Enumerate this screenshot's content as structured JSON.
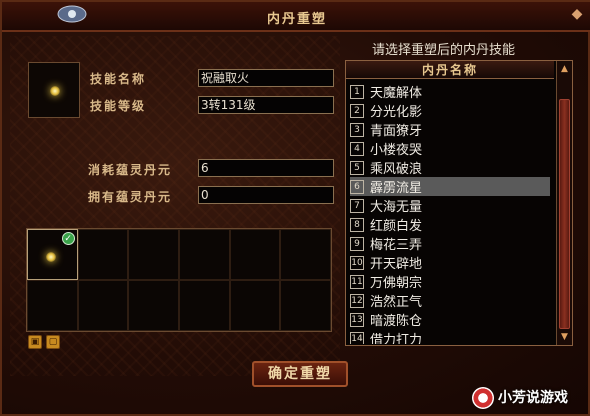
{
  "window": {
    "title": "内丹重塑",
    "close_label": "◆"
  },
  "skill": {
    "name_label": "技能名称",
    "name_value": "祝融取火",
    "level_label": "技能等级",
    "level_value": "3转131级"
  },
  "spirit": {
    "consume_label": "消耗蕴灵丹元",
    "consume_value": "6",
    "owned_label": "拥有蕴灵丹元",
    "owned_value": "0"
  },
  "inventory": {
    "slots": 12,
    "first_slot_checked": true
  },
  "actions": {
    "confirm_label": "确定重塑"
  },
  "list": {
    "prompt": "请选择重塑后的内丹技能",
    "header": "内丹名称",
    "selected_index": 5,
    "items": [
      {
        "num": "1",
        "name": "天魔解体"
      },
      {
        "num": "2",
        "name": "分光化影"
      },
      {
        "num": "3",
        "name": "青面獠牙"
      },
      {
        "num": "4",
        "name": "小楼夜哭"
      },
      {
        "num": "5",
        "name": "乘风破浪"
      },
      {
        "num": "6",
        "name": "霹雳流星"
      },
      {
        "num": "7",
        "name": "大海无量"
      },
      {
        "num": "8",
        "name": "红颜白发"
      },
      {
        "num": "9",
        "name": "梅花三弄"
      },
      {
        "num": "10",
        "name": "开天辟地"
      },
      {
        "num": "11",
        "name": "万佛朝宗"
      },
      {
        "num": "12",
        "name": "浩然正气"
      },
      {
        "num": "13",
        "name": "暗渡陈仓"
      },
      {
        "num": "14",
        "name": "借力打力"
      }
    ]
  },
  "watermark": {
    "text": "小芳说游戏"
  },
  "colors": {
    "frame": "#5a2a14",
    "accent": "#e8c890",
    "selected": "#5a5a5a"
  }
}
